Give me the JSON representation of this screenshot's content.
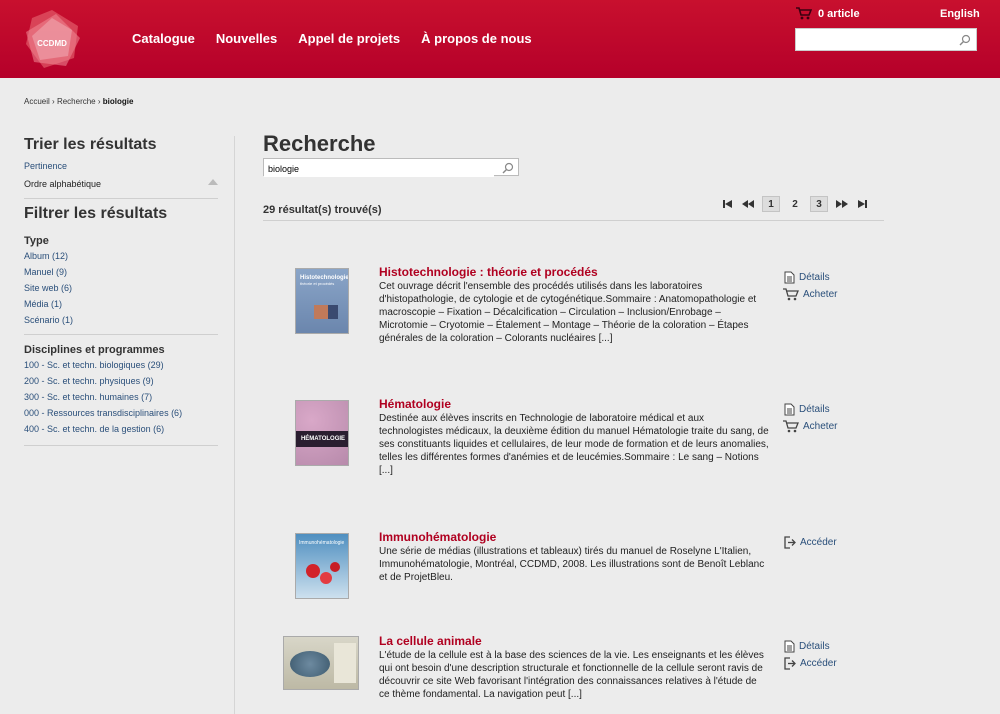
{
  "header": {
    "logo_text": "CCDMD",
    "nav": [
      "Catalogue",
      "Nouvelles",
      "Appel de projets",
      "À propos de nous"
    ],
    "cart_label": "0 article",
    "lang_label": "English",
    "search_value": "",
    "brand_color": "#c8102e"
  },
  "breadcrumb": {
    "home": "Accueil",
    "sep1": "›",
    "search": "Recherche",
    "sep2": "›",
    "current": "biologie"
  },
  "sidebar": {
    "sort_title": "Trier les résultats",
    "sort_options": [
      "Pertinence",
      "Ordre alphabétique"
    ],
    "filter_title": "Filtrer les résultats",
    "type_title": "Type",
    "types": [
      "Album (12)",
      "Manuel (9)",
      "Site web (6)",
      "Média (1)",
      "Scénario (1)"
    ],
    "disc_title": "Disciplines et programmes",
    "disciplines": [
      "100 - Sc. et techn. biologiques (29)",
      "200 - Sc. et techn. physiques (9)",
      "300 - Sc. et techn. humaines (7)",
      "000 - Ressources transdisciplinaires (6)",
      "400 - Sc. et techn. de la gestion (6)"
    ]
  },
  "main": {
    "title": "Recherche",
    "search_value": "biologie",
    "count": "29 résultat(s) trouvé(s)",
    "pages": [
      "1",
      "2",
      "3"
    ]
  },
  "results": [
    {
      "title": "Histotechnologie : théorie et procédés",
      "desc": "Cet ouvrage décrit l'ensemble des procédés utilisés dans les laboratoires d'histopathologie, de cytologie et de cytogénétique.Sommaire : Anatomopathologie et macroscopie – Fixation – Décalcification – Circulation – Inclusion/Enrobage – Microtomie – Cryotomie – Étalement – Montage – Théorie de la coloration – Étapes générales de la coloration – Colorants nucléaires [...]",
      "actions": [
        "Détails",
        "Acheter"
      ],
      "cover_title": "Histotechnologie",
      "cover_subtitle": "théorie et procédés"
    },
    {
      "title": "Hématologie",
      "desc": "Destinée aux élèves inscrits en Technologie de laboratoire médical et aux technologistes médicaux, la deuxième édition du manuel Hématologie traite du sang, de ses constituants liquides et cellulaires, de leur mode de formation et de leurs anomalies, telles les différentes formes d'anémies et de leucémies.Sommaire : Le sang – Notions [...]",
      "actions": [
        "Détails",
        "Acheter"
      ],
      "cover_title": "HÉMATOLOGIE"
    },
    {
      "title": "Immunohématologie",
      "desc": "Une série de médias (illustrations et tableaux) tirés du manuel de Roselyne L'Italien, Immunohématologie, Montréal, CCDMD, 2008. Les illustrations sont de Benoît Leblanc et de ProjetBleu.",
      "actions": [
        "Accéder"
      ],
      "cover_title": "Immunohématologie"
    },
    {
      "title": "La cellule animale",
      "desc": "L'étude de la cellule est à la base des sciences de la vie. Les enseignants et les élèves qui ont besoin d'une description structurale et fonctionnelle de la cellule seront ravis de découvrir ce site Web favorisant l'intégration des connaissances relatives à l'étude de ce thème fondamental. La navigation peut [...]",
      "actions": [
        "Détails",
        "Accéder"
      ]
    }
  ]
}
